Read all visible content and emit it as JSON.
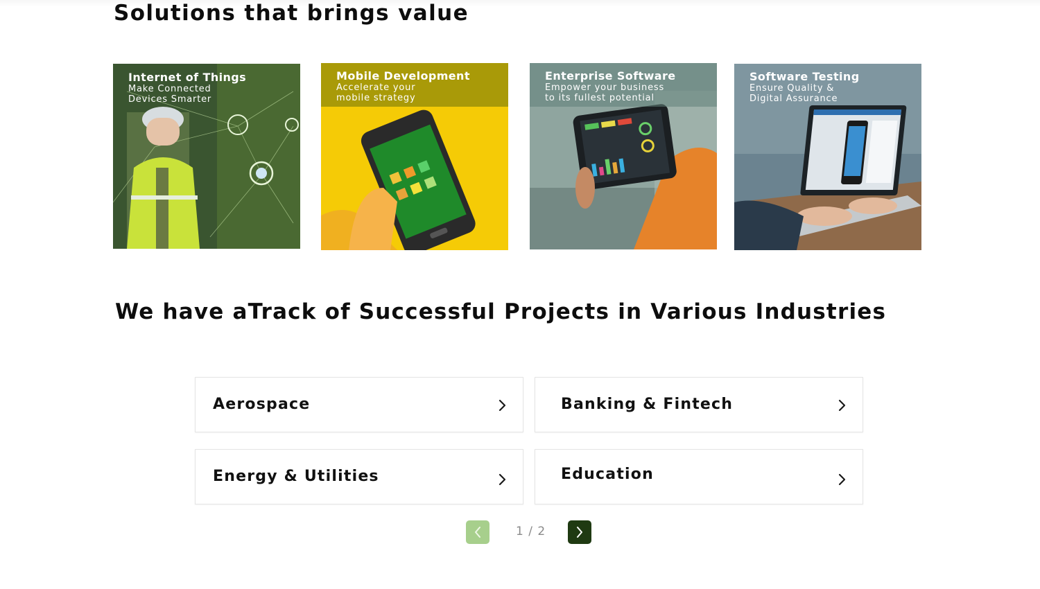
{
  "solutions": {
    "title": "Solutions that brings value",
    "cards": [
      {
        "title": "Internet of Things",
        "subtitle_1": "Make Connected",
        "subtitle_2": "Devices Smarter"
      },
      {
        "title": "Mobile Development",
        "subtitle_1": "Accelerate your",
        "subtitle_2": "mobile strategy"
      },
      {
        "title": "Enterprise Software",
        "subtitle_1": "Empower your business",
        "subtitle_2": "to its fullest potential"
      },
      {
        "title": "Software Testing",
        "subtitle_1": "Ensure Quality &",
        "subtitle_2": "Digital Assurance"
      }
    ]
  },
  "industries": {
    "title": "We have aTrack of Successful Projects in Various Industries",
    "items": [
      {
        "label": "Aerospace",
        "icon": "chevron-right-icon"
      },
      {
        "label": "Banking & Fintech",
        "icon": "chevron-right-icon"
      },
      {
        "label": "Energy & Utilities",
        "icon": "chevron-right-icon"
      },
      {
        "label": "Education",
        "icon": "chevron-right-icon"
      }
    ],
    "pagination": {
      "counter": "1 / 2",
      "prev_icon": "chevron-left-icon",
      "next_icon": "chevron-right-icon"
    }
  },
  "colors": {
    "pagination_prev": "#a7cf8c",
    "pagination_next": "#1f3a12",
    "mobile_band": "#a99a08"
  }
}
